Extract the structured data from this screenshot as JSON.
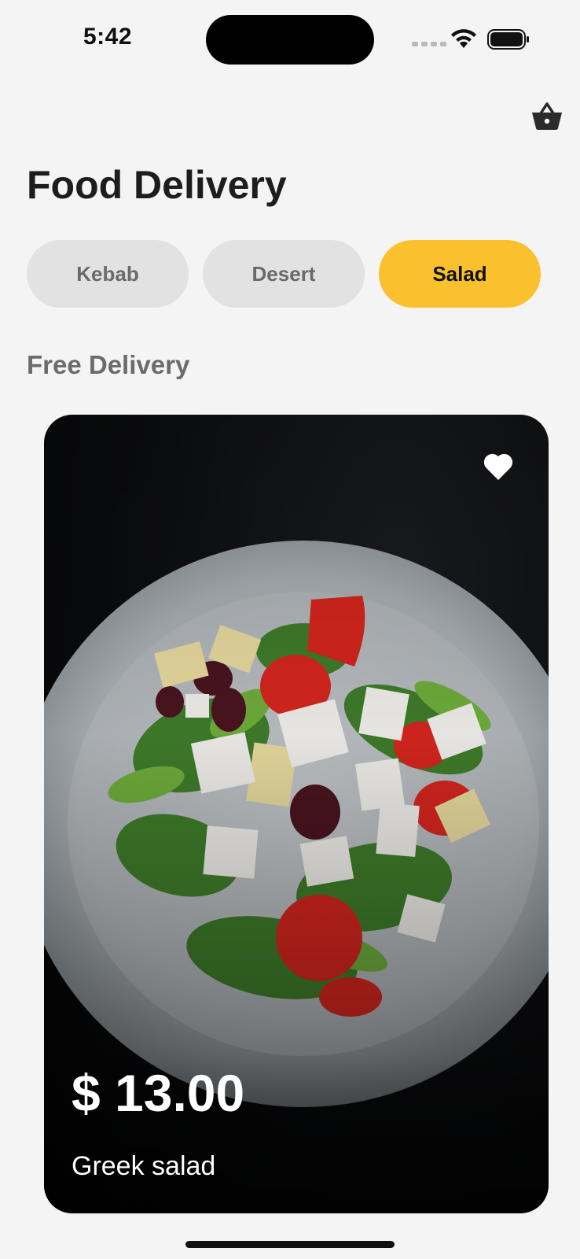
{
  "status_bar": {
    "time": "5:42",
    "icons": [
      "signal-icon",
      "wifi-icon",
      "battery-icon"
    ]
  },
  "header": {
    "cart_icon": "basket-icon",
    "title": "Food Delivery"
  },
  "categories": {
    "tabs": [
      {
        "label": "Kebab",
        "active": false
      },
      {
        "label": "Desert",
        "active": false
      },
      {
        "label": "Salad",
        "active": true
      }
    ],
    "active_color": "#fbc02d",
    "inactive_color": "#e2e2e2"
  },
  "section": {
    "label": "Free Delivery"
  },
  "food_card": {
    "price": "$ 13.00",
    "name": "Greek salad",
    "favorite_icon": "heart-icon"
  }
}
